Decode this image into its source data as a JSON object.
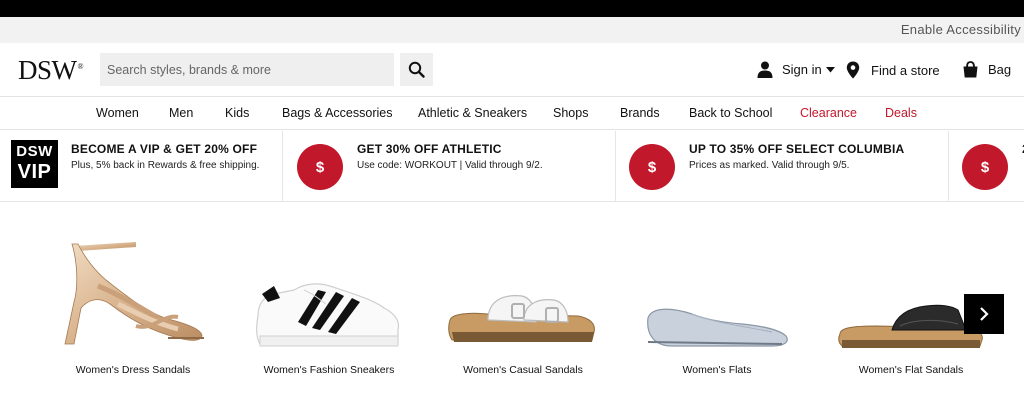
{
  "accessibility": {
    "label": "Enable Accessibility"
  },
  "header": {
    "logo": "DSW",
    "logo_mark": "®",
    "search": {
      "placeholder": "Search styles, brands & more",
      "value": ""
    },
    "sign_in": "Sign in",
    "find_store": "Find a store",
    "bag": "Bag"
  },
  "nav": {
    "items": [
      {
        "label": "Women"
      },
      {
        "label": "Men"
      },
      {
        "label": "Kids"
      },
      {
        "label": "Bags & Accessories"
      },
      {
        "label": "Athletic & Sneakers"
      },
      {
        "label": "Shops"
      },
      {
        "label": "Brands"
      },
      {
        "label": "Back to School"
      },
      {
        "label": "Clearance",
        "color": "#c2182b"
      },
      {
        "label": "Deals",
        "color": "#c2182b"
      }
    ]
  },
  "promos": [
    {
      "badge_line1": "DSW",
      "badge_line2": "VIP",
      "title": "BECOME A VIP & GET 20% OFF",
      "subtitle": "Plus, 5% back in Rewards & free shipping."
    },
    {
      "icon_text": "$",
      "title": "GET 30% OFF ATHLETIC",
      "subtitle": "Use code: WORKOUT | Valid through 9/2."
    },
    {
      "icon_text": "$",
      "title": "UP TO 35% OFF SELECT COLUMBIA",
      "subtitle": "Prices as marked. Valid through 9/5."
    },
    {
      "icon_text": "$",
      "title": "2"
    }
  ],
  "products": [
    {
      "label": "Women's Dress Sandals",
      "icon": "dress-sandal-image"
    },
    {
      "label": "Women's Fashion Sneakers",
      "icon": "sneaker-image"
    },
    {
      "label": "Women's Casual Sandals",
      "icon": "casual-sandal-image"
    },
    {
      "label": "Women's Flats",
      "icon": "flat-shoe-image"
    },
    {
      "label": "Women's Flat Sandals",
      "icon": "flat-sandal-image"
    }
  ],
  "colors": {
    "accent": "#c2182b",
    "black": "#000000"
  }
}
